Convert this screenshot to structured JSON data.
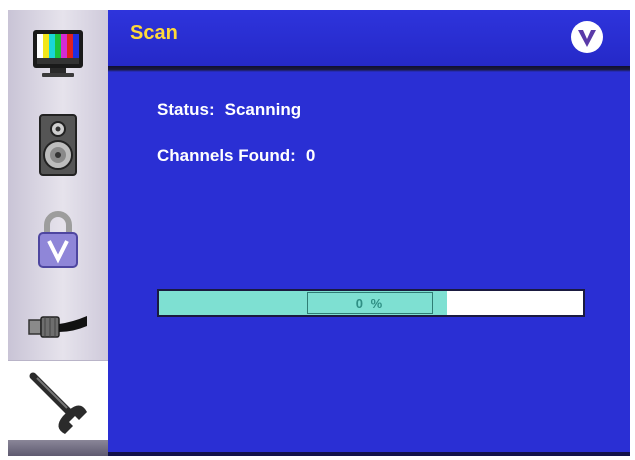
{
  "header": {
    "title": "Scan",
    "logo_icon": "vizio-v-logo-icon"
  },
  "sidebar": {
    "items": [
      {
        "name": "picture",
        "icon": "tv-color-bars-icon",
        "selected": false
      },
      {
        "name": "audio",
        "icon": "speaker-icon",
        "selected": false
      },
      {
        "name": "parental",
        "icon": "padlock-icon",
        "selected": false
      },
      {
        "name": "input",
        "icon": "coax-cable-icon",
        "selected": false
      },
      {
        "name": "setup",
        "icon": "wrench-icon",
        "selected": true
      }
    ]
  },
  "status": {
    "label": "Status:",
    "value": "Scanning"
  },
  "channels": {
    "label": "Channels Found:",
    "value": "0"
  },
  "progress": {
    "percent": 0,
    "fill_fraction": 0.68,
    "label": "0 %"
  },
  "colors": {
    "background": "#2a2fd4",
    "title": "#ffd93a",
    "progress_fill": "#7ee0d2"
  }
}
